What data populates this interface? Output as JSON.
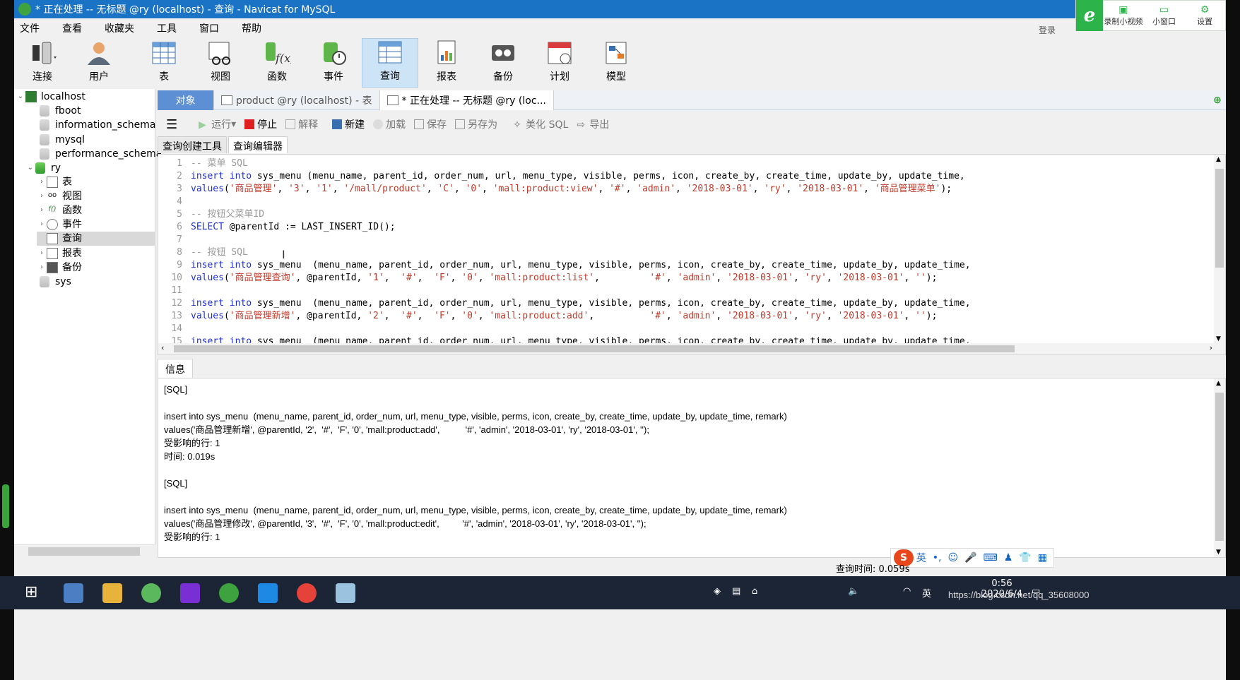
{
  "window": {
    "title": "* 正在处理 -- 无标题 @ry (localhost) - 查询 - Navicat for MySQL"
  },
  "recorder": {
    "logo": "e",
    "record_label": "录制小视频",
    "mini_label": "小窗口",
    "settings_label": "设置"
  },
  "menubar": [
    "文件",
    "查看",
    "收藏夹",
    "工具",
    "窗口",
    "帮助"
  ],
  "login_label": "登录",
  "toolbar": {
    "connect": "连接",
    "user": "用户",
    "table": "表",
    "view": "视图",
    "function": "函数",
    "event": "事件",
    "query": "查询",
    "report": "报表",
    "backup": "备份",
    "schedule": "计划",
    "model": "模型"
  },
  "sidebar": {
    "items": [
      {
        "label": "localhost"
      },
      {
        "label": "fboot"
      },
      {
        "label": "information_schema"
      },
      {
        "label": "mysql"
      },
      {
        "label": "performance_schema"
      },
      {
        "label": "ry"
      },
      {
        "label": "表"
      },
      {
        "label": "视图"
      },
      {
        "label": "函数"
      },
      {
        "label": "事件"
      },
      {
        "label": "查询"
      },
      {
        "label": "报表"
      },
      {
        "label": "备份"
      },
      {
        "label": "sys"
      }
    ]
  },
  "tabs": [
    {
      "label": "对象"
    },
    {
      "label": "product @ry (localhost) - 表"
    },
    {
      "label": "* 正在处理 -- 无标题 @ry (loc..."
    }
  ],
  "query_toolbar": {
    "run": "运行",
    "stop": "停止",
    "explain": "解释",
    "new": "新建",
    "load": "加载",
    "save": "保存",
    "save_as": "另存为",
    "beautify": "美化 SQL",
    "export": "导出"
  },
  "subtabs": [
    "查询创建工具",
    "查询编辑器"
  ],
  "editor": {
    "lines": [
      "-- 菜单 SQL",
      "insert into sys_menu (menu_name, parent_id, order_num, url, menu_type, visible, perms, icon, create_by, create_time, update_by, update_time,",
      "values('商品管理', '3', '1', '/mall/product', 'C', '0', 'mall:product:view', '#', 'admin', '2018-03-01', 'ry', '2018-03-01', '商品管理菜单');",
      "",
      "-- 按钮父菜单ID",
      "SELECT @parentId := LAST_INSERT_ID();",
      "",
      "-- 按钮 SQL",
      "insert into sys_menu  (menu_name, parent_id, order_num, url, menu_type, visible, perms, icon, create_by, create_time, update_by, update_time,",
      "values('商品管理查询', @parentId, '1',  '#',  'F', '0', 'mall:product:list',         '#', 'admin', '2018-03-01', 'ry', '2018-03-01', '');",
      "",
      "insert into sys_menu  (menu_name, parent_id, order_num, url, menu_type, visible, perms, icon, create_by, create_time, update_by, update_time,",
      "values('商品管理新增', @parentId, '2',  '#',  'F', '0', 'mall:product:add',          '#', 'admin', '2018-03-01', 'ry', '2018-03-01', '');",
      "",
      "insert into sys_menu  (menu_name, parent_id, order_num, url, menu_type, visible, perms, icon, create_by, create_time, update_by, update_time,"
    ],
    "line_numbers": [
      "1",
      "2",
      "3",
      "4",
      "5",
      "6",
      "7",
      "8",
      "9",
      "10",
      "11",
      "12",
      "13",
      "14",
      "15"
    ]
  },
  "info": {
    "tab_label": "信息",
    "lines": [
      "[SQL]",
      "",
      "insert into sys_menu  (menu_name, parent_id, order_num, url, menu_type, visible, perms, icon, create_by, create_time, update_by, update_time, remark)",
      "values('商品管理新增', @parentId, '2',  '#',  'F', '0', 'mall:product:add',          '#', 'admin', '2018-03-01', 'ry', '2018-03-01', '');",
      "受影响的行: 1",
      "时间: 0.019s",
      "",
      "[SQL]",
      "",
      "insert into sys_menu  (menu_name, parent_id, order_num, url, menu_type, visible, perms, icon, create_by, create_time, update_by, update_time, remark)",
      "values('商品管理修改', @parentId, '3',  '#',  'F', '0', 'mall:product:edit',         '#', 'admin', '2018-03-01', 'ry', '2018-03-01', '');",
      "受影响的行: 1"
    ]
  },
  "status": {
    "query_time": "查询时间: 0.059s"
  },
  "ime": {
    "mode": "英"
  },
  "taskbar": {
    "time": "0:56",
    "date": "2020/6/4",
    "lang": "英"
  },
  "watermark": "https://blog.csdn.net/qq_35608000"
}
